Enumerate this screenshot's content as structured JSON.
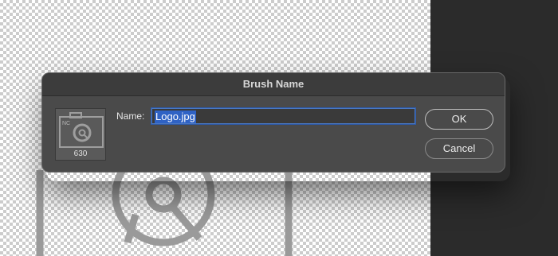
{
  "dialog": {
    "title": "Brush Name",
    "name_label": "Name:",
    "name_value": "Logo.jpg",
    "brush_size": "630",
    "ok_label": "OK",
    "cancel_label": "Cancel"
  },
  "brush_preview": {
    "icon": "camera-icon",
    "badge_text": "NC"
  },
  "colors": {
    "dialog_bg": "#4a4a4a",
    "titlebar_bg": "#3c3c3c",
    "selection": "#2f62c4",
    "focus_ring": "#4a78c2",
    "dark_panel": "#2b2b2b"
  }
}
